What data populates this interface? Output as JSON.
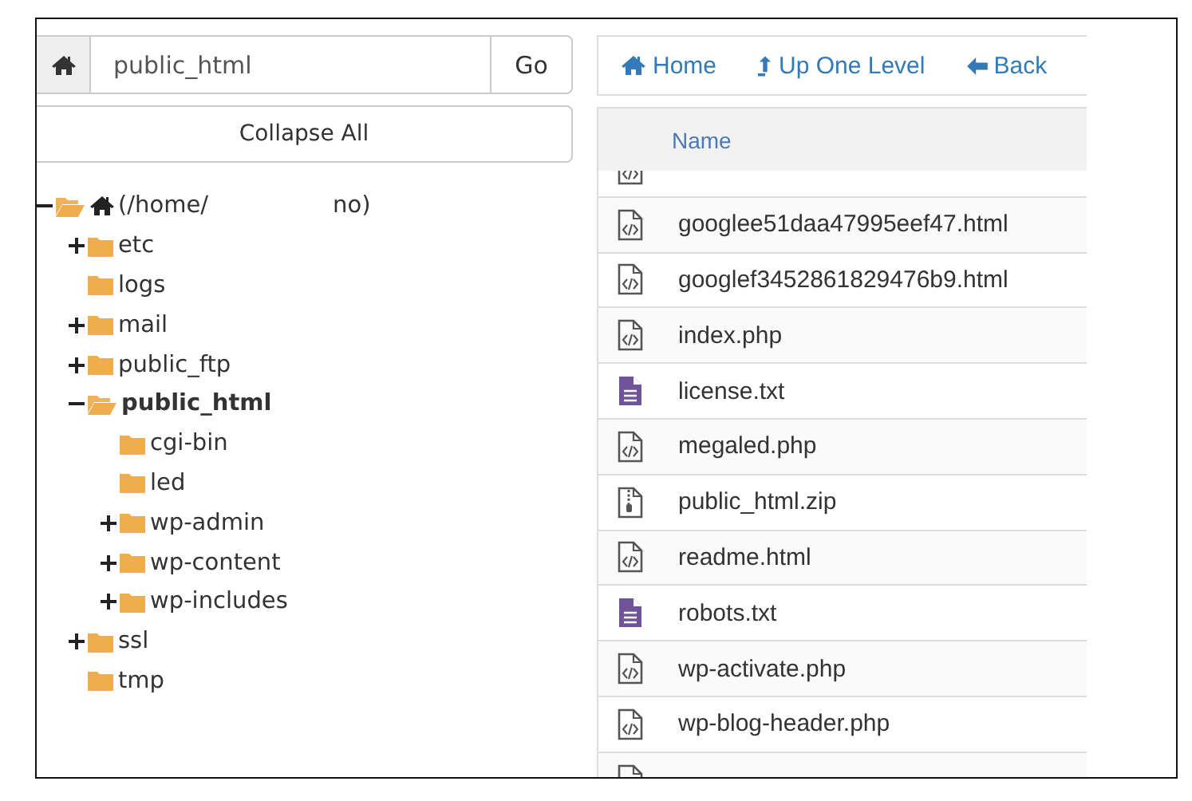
{
  "path_bar": {
    "value": "public_html",
    "go_label": "Go"
  },
  "collapse_label": "Collapse All",
  "tree": {
    "label_start": "(/home/",
    "label_end": "no)",
    "expanded": true,
    "children": [
      {
        "label": "etc",
        "expandable": true,
        "expanded": false,
        "selected": false
      },
      {
        "label": "logs",
        "expandable": false,
        "expanded": false,
        "selected": false
      },
      {
        "label": "mail",
        "expandable": true,
        "expanded": false,
        "selected": false
      },
      {
        "label": "public_ftp",
        "expandable": true,
        "expanded": false,
        "selected": false
      },
      {
        "label": "public_html",
        "expandable": true,
        "expanded": true,
        "selected": true,
        "children": [
          {
            "label": "cgi-bin",
            "expandable": false,
            "expanded": false,
            "selected": false
          },
          {
            "label": "led",
            "expandable": false,
            "expanded": false,
            "selected": false
          },
          {
            "label": "wp-admin",
            "expandable": true,
            "expanded": false,
            "selected": false
          },
          {
            "label": "wp-content",
            "expandable": true,
            "expanded": false,
            "selected": false
          },
          {
            "label": "wp-includes",
            "expandable": true,
            "expanded": false,
            "selected": false
          }
        ]
      },
      {
        "label": "ssl",
        "expandable": true,
        "expanded": false,
        "selected": false
      },
      {
        "label": "tmp",
        "expandable": false,
        "expanded": false,
        "selected": false
      }
    ]
  },
  "toolbar": [
    {
      "kind": "home",
      "label": "Home"
    },
    {
      "kind": "up",
      "label": "Up One Level"
    },
    {
      "kind": "back",
      "label": "Back"
    }
  ],
  "table": {
    "columns": [
      "Name"
    ],
    "rows": [
      {
        "kind": "code"
      },
      {
        "kind": "code",
        "name": "googlee51daa47995eef47.html"
      },
      {
        "kind": "code",
        "name": "googlef3452861829476b9.html"
      },
      {
        "kind": "code",
        "name": "index.php"
      },
      {
        "kind": "text",
        "name": "license.txt"
      },
      {
        "kind": "code",
        "name": "megaled.php"
      },
      {
        "kind": "zip",
        "name": "public_html.zip"
      },
      {
        "kind": "code",
        "name": "readme.html"
      },
      {
        "kind": "text",
        "name": "robots.txt"
      },
      {
        "kind": "code",
        "name": "wp-activate.php"
      },
      {
        "kind": "code",
        "name": "wp-blog-header.php"
      },
      {
        "kind": "code"
      }
    ]
  }
}
